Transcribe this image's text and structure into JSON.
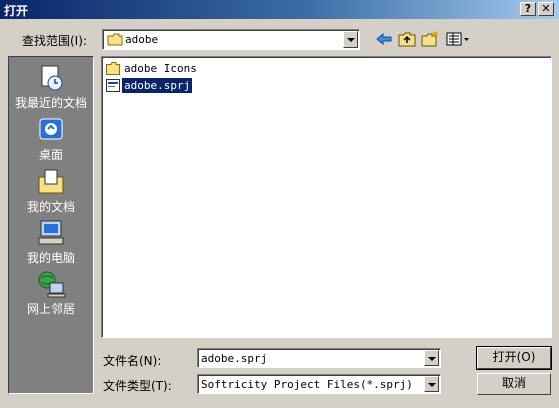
{
  "window": {
    "title": "打开",
    "help_button": "?",
    "close_button": "✕"
  },
  "toolbar": {
    "look_in_label": "查找范围(I):",
    "look_in_value": "adobe",
    "icons": [
      "back-arrow-icon",
      "up-folder-icon",
      "new-folder-icon",
      "view-menu-icon"
    ]
  },
  "places": [
    {
      "label": "我最近的文档",
      "icon": "recent-documents-icon"
    },
    {
      "label": "桌面",
      "icon": "desktop-icon"
    },
    {
      "label": "我的文档",
      "icon": "my-documents-icon"
    },
    {
      "label": "我的电脑",
      "icon": "my-computer-icon"
    },
    {
      "label": "网上邻居",
      "icon": "network-places-icon"
    }
  ],
  "files": [
    {
      "name": "adobe Icons",
      "type": "folder",
      "selected": false
    },
    {
      "name": "adobe.sprj",
      "type": "file",
      "selected": true
    }
  ],
  "filename": {
    "label": "文件名(N):",
    "value": "adobe.sprj"
  },
  "filetype": {
    "label": "文件类型(T):",
    "value": "Softricity Project Files(*.sprj)"
  },
  "buttons": {
    "open": "打开(O)",
    "cancel": "取消"
  },
  "colors": {
    "title_start": "#0a246a",
    "title_end": "#a6caf0",
    "face": "#d4d0c8",
    "selection": "#0a246a"
  }
}
